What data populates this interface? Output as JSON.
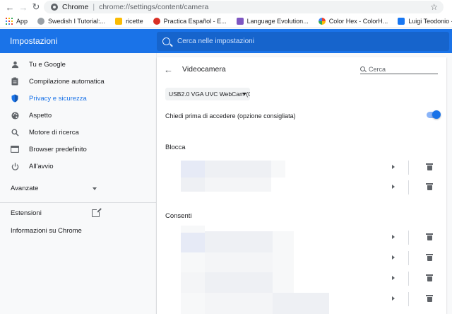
{
  "toolbar": {
    "origin": "Chrome",
    "url": "chrome://settings/content/camera"
  },
  "bookmarks": [
    {
      "label": "App",
      "color": "#ea4335"
    },
    {
      "label": "Swedish I Tutorial:...",
      "color": "#9aa0a6"
    },
    {
      "label": "ricette",
      "color": "#fbbc04"
    },
    {
      "label": "Practica Español - E...",
      "color": "#d93025"
    },
    {
      "label": "Language Evolution...",
      "color": "#7e57c2"
    },
    {
      "label": "Color Hex - ColorH...",
      "color": "#34a853"
    },
    {
      "label": "Luigi Teodonio - Al...",
      "color": "#1877f2"
    }
  ],
  "header": {
    "title": "Impostazioni",
    "search_placeholder": "Cerca nelle impostazioni"
  },
  "sidebar": {
    "items": [
      {
        "label": "Tu e Google",
        "icon": "person-icon"
      },
      {
        "label": "Compilazione automatica",
        "icon": "clipboard-icon"
      },
      {
        "label": "Privacy e sicurezza",
        "icon": "shield-icon"
      },
      {
        "label": "Aspetto",
        "icon": "palette-icon"
      },
      {
        "label": "Motore di ricerca",
        "icon": "search-icon"
      },
      {
        "label": "Browser predefinito",
        "icon": "browser-icon"
      },
      {
        "label": "All'avvio",
        "icon": "power-icon"
      }
    ],
    "advanced": "Avanzate",
    "extensions": "Estensioni",
    "about": "Informazioni su Chrome"
  },
  "main": {
    "title": "Videocamera",
    "search_placeholder": "Cerca",
    "device": "USB2.0 VGA UVC WebCam (0",
    "ask_label": "Chiedi prima di accedere (opzione consigliata)",
    "ask_enabled": true,
    "block_title": "Blocca",
    "allow_title": "Consenti"
  },
  "colors": {
    "accent": "#1a73e8",
    "header": "#1a73e8",
    "sidebar_bg": "#f8f9fa"
  }
}
